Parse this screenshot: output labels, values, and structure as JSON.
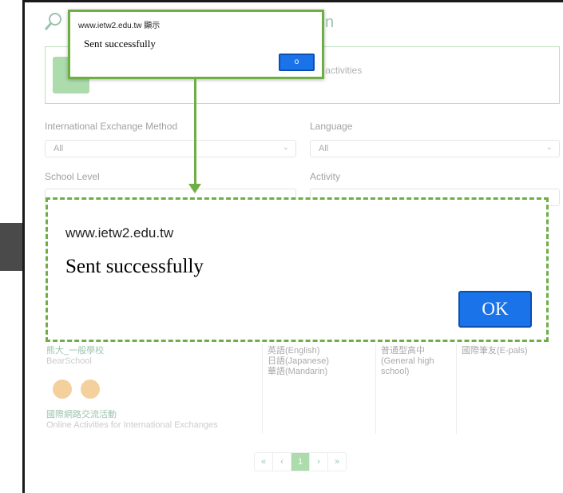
{
  "mini_dialog": {
    "origin": "www.ietw2.edu.tw 顯示",
    "message": "Sent successfully",
    "ok_label": "o"
  },
  "big_dialog": {
    "origin": "www.ietw2.edu.tw",
    "message": "Sent successfully",
    "ok_label": "OK"
  },
  "page": {
    "title_fragment": "n",
    "banner_text": "ods, languages, school level and types of exchange activities",
    "filters": {
      "method_label": "International Exchange Method",
      "method_value": "All",
      "language_label": "Language",
      "language_value": "All",
      "school_level_label": "School Level",
      "activity_label": "Activity"
    },
    "result": {
      "school_name_zh": "熊大_一般學校",
      "school_name_en": "BearSchool",
      "languages": [
        "英語(English)",
        "日語(Japanese)",
        "華語(Mandarin)"
      ],
      "level": "普通型高中 (General high school)",
      "activity": "國際筆友(E-pals)",
      "online_zh": "國際網路交流活動",
      "online_en": "Online Activities for International Exchanges"
    },
    "pager": [
      "«",
      "‹",
      "1",
      "›",
      "»"
    ]
  },
  "colors": {
    "accent_green": "#6fae45",
    "ok_blue": "#1a73e8"
  }
}
